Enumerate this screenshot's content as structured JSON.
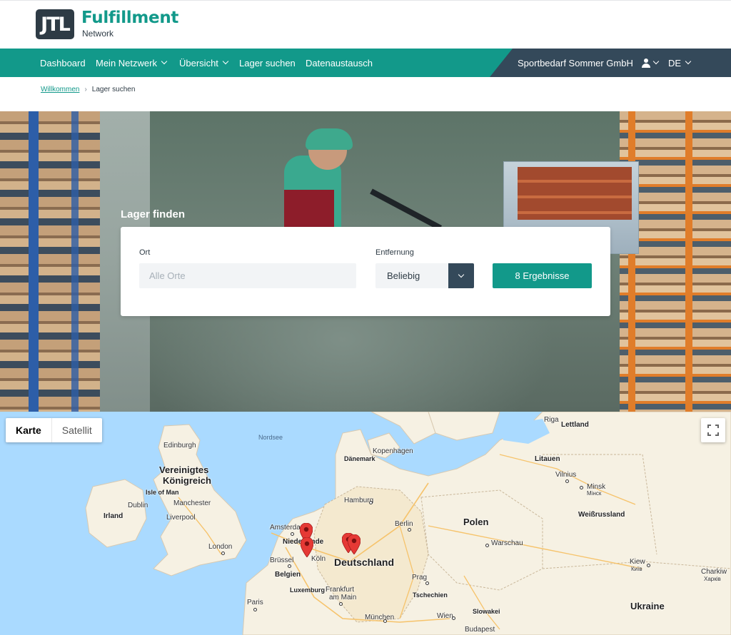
{
  "brand": {
    "logo_text": "JTL",
    "name": "Fulfillment",
    "sub": "Network",
    "accent_color": "#12998a",
    "dark_color": "#34495a"
  },
  "nav": {
    "items": [
      {
        "label": "Dashboard"
      },
      {
        "label": "Mein Netzwerk"
      },
      {
        "label": "Übersicht"
      },
      {
        "label": "Lager suchen"
      },
      {
        "label": "Datenaustausch"
      }
    ],
    "company": "Sportbedarf Sommer GmbH",
    "user_icon": "user-icon",
    "language": "DE"
  },
  "breadcrumb": {
    "home": "Willkommen",
    "current": "Lager suchen"
  },
  "search": {
    "title": "Lager finden",
    "ort_label": "Ort",
    "ort_placeholder": "Alle Orte",
    "ort_value": "",
    "distance_label": "Entfernung",
    "distance_value": "Beliebig",
    "results_button": "8 Ergebnisse"
  },
  "map": {
    "tabs": [
      {
        "label": "Karte",
        "active": true
      },
      {
        "label": "Satellit",
        "active": false
      }
    ],
    "fullscreen_icon": "fullscreen-icon",
    "pin_color": "#e53935",
    "labels": {
      "nordsee": "Nordsee",
      "edinburgh": "Edinburgh",
      "uk_line1": "Vereinigtes",
      "uk_line2": "Königreich",
      "isle_of_man": "Isle of Man",
      "dublin": "Dublin",
      "irland": "Irland",
      "manchester": "Manchester",
      "liverpool": "Liverpool",
      "london": "London",
      "amsterdam": "Amsterdam",
      "niederlande": "Niederlande",
      "bruessel": "Brüssel",
      "belgien": "Belgien",
      "luxemburg": "Luxemburg",
      "paris": "Paris",
      "koeln": "Köln",
      "frankfurt_line1": "Frankfurt",
      "frankfurt_line2": "am Main",
      "deutschland": "Deutschland",
      "hamburg": "Hamburg",
      "berlin": "Berlin",
      "kopenhagen": "Kopenhagen",
      "daenemark": "Dänemark",
      "prag": "Prag",
      "tschechien": "Tschechien",
      "muenchen": "München",
      "wien": "Wien",
      "slowakei": "Slowakei",
      "budapest": "Budapest",
      "polen": "Polen",
      "warschau": "Warschau",
      "riga": "Riga",
      "lettland": "Lettland",
      "litauen": "Litauen",
      "vilnius": "Vilnius",
      "minsk": "Minsk",
      "minsk_cyr": "Мінск",
      "weissrussland": "Weißrussland",
      "kiew": "Kiew",
      "kiew_cyr": "Київ",
      "charkiw": "Charkiw",
      "charkiw_cyr": "Харків",
      "ukraine": "Ukraine"
    }
  }
}
